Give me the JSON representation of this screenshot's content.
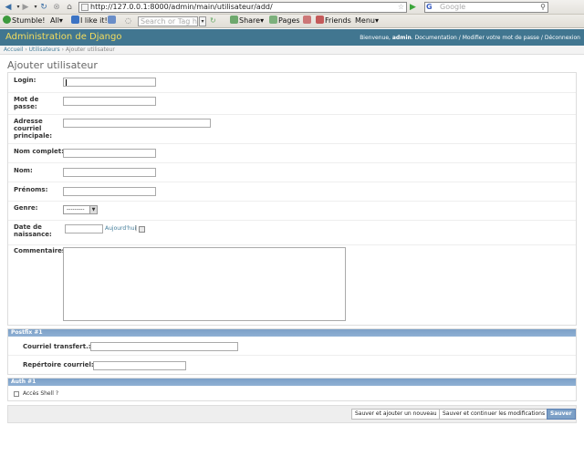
{
  "browser": {
    "url": "http://127.0.0.1:8000/admin/main/utilisateur/add/",
    "search_placeholder": "Google",
    "search_engine_letter": "G"
  },
  "toolbar": {
    "stumble_label": "Stumble!",
    "all_label": "All",
    "ilike_label": "I like it!",
    "tag_search_placeholder": "Search or Tag his",
    "share_label": "Share",
    "pages_label": "Pages",
    "friends_label": "Friends",
    "menu_label": "Menu"
  },
  "header": {
    "brand": "Administration de Django",
    "welcome": "Bienvenue,",
    "username": "admin",
    "links": "Documentation / Modifier votre mot de passe / Déconnexion"
  },
  "breadcrumbs": {
    "home": "Accueil",
    "section": "Utilisateurs",
    "current": "Ajouter utilisateur"
  },
  "page_title": "Ajouter utilisateur",
  "form": {
    "login_label": "Login:",
    "password_label_1": "Mot de",
    "password_label_2": "passe:",
    "email_label_1": "Adresse",
    "email_label_2": "courriel",
    "email_label_3": "principale:",
    "fullname_label": "Nom complet:",
    "lastname_label": "Nom:",
    "firstname_label": "Prénoms:",
    "gender_label": "Genre:",
    "gender_value": "---------",
    "birthdate_label_1": "Date de",
    "birthdate_label_2": "naissance:",
    "today_link": "Aujourd'hui",
    "separator": "|",
    "comments_label": "Commentaires:"
  },
  "postfix": {
    "title": "Postfix #1",
    "forward_label": "Courriel transfert.:",
    "mailbox_label": "Repértoire courriel:"
  },
  "auth": {
    "title": "Auth #1",
    "shell_label": "Accès Shell ?"
  },
  "buttons": {
    "save_add": "Sauver et ajouter un nouveau",
    "save_continue": "Sauver et continuer les modifications",
    "save": "Sauver"
  }
}
